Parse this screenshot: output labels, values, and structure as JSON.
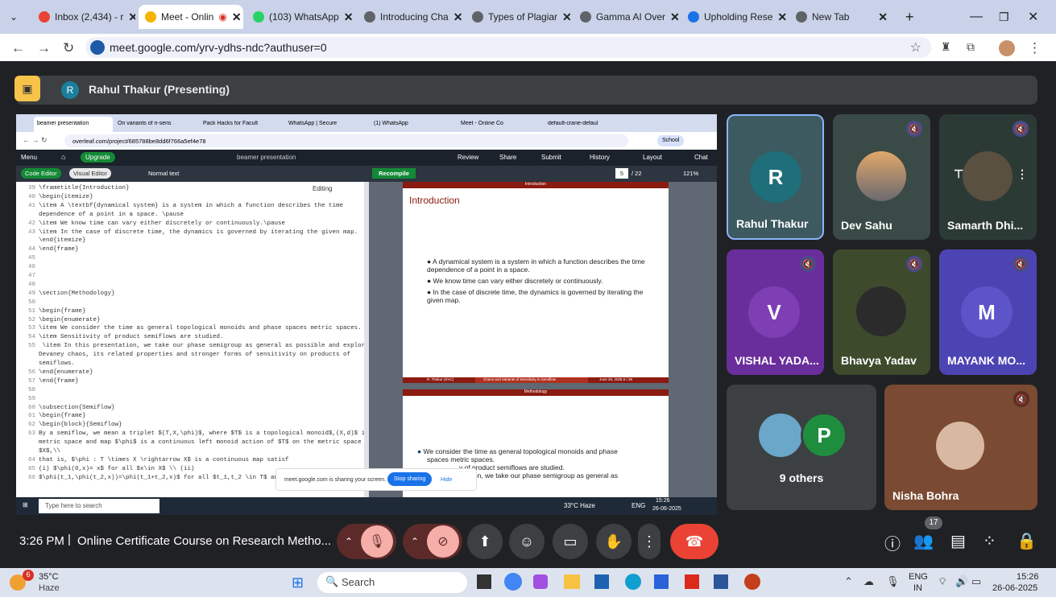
{
  "browser_tabs": [
    {
      "label": "Inbox (2,434) - r"
    },
    {
      "label": "Meet - Onlin"
    },
    {
      "label": "(103) WhatsApp"
    },
    {
      "label": "Introducing Cha"
    },
    {
      "label": "Types of Plagiar"
    },
    {
      "label": "Gamma AI Over"
    },
    {
      "label": "Upholding Rese"
    },
    {
      "label": "New Tab"
    }
  ],
  "url": "meet.google.com/yrv-ydhs-ndc?authuser=0",
  "presenter": {
    "initial": "R",
    "label": "Rahul Thakur (Presenting)"
  },
  "inner": {
    "tabs": [
      "beamer presentation",
      "On variants of n-sens",
      "Pack Hacks for Facult",
      "WhatsApp | Secure",
      "(1) WhatsApp",
      "Meet - Online Co",
      "default-crane-defaul"
    ],
    "url": "overleaf.com/project/685788be8dd6f766a5ef4e78",
    "school": "School",
    "menu": "Menu",
    "upgrade": "Upgrade",
    "title": "beamer presentation",
    "review": "Review",
    "share": "Share",
    "submit": "Submit",
    "history": "History",
    "layout": "Layout",
    "chat": "Chat",
    "code_editor": "Code Editor",
    "visual_editor": "Visual Editor",
    "normal_text": "Normal text",
    "editing": "Editing",
    "recompile": "Recompile",
    "page": "5",
    "pages": "/ 22",
    "zoom": "121%",
    "code_lines": [
      [
        "39",
        "\\frametitle{Introduction}"
      ],
      [
        "40",
        "\\begin{itemize}"
      ],
      [
        "41",
        "\\item A \\textbf{dynamical system} is a system in which a function describes the time"
      ],
      [
        "",
        "dependence of a point in a space. \\pause"
      ],
      [
        "42",
        "\\item We know time can vary either discretely or continuously.\\pause"
      ],
      [
        "43",
        "\\item In the case of discrete time, the dynamics is governed by iterating the given map."
      ],
      [
        "",
        "\\end{itemize}"
      ],
      [
        "44",
        "\\end{frame}"
      ],
      [
        "45",
        ""
      ],
      [
        "46",
        ""
      ],
      [
        "47",
        ""
      ],
      [
        "48",
        ""
      ],
      [
        "49",
        "\\section{Methodology}"
      ],
      [
        "50",
        ""
      ],
      [
        "51",
        "\\begin{frame}"
      ],
      [
        "52",
        "\\begin{enumerate}"
      ],
      [
        "53",
        "\\item  We consider the time as general topological monoids and phase spaces metric spaces."
      ],
      [
        "54",
        "\\item  Sensitivity of product semiflows are studied."
      ],
      [
        "55",
        " \\item In this presentation, we take our phase semigroup as general as possible and explore"
      ],
      [
        "",
        "Devaney chaos, its related properties and stronger forms of sensitivity on products of"
      ],
      [
        "",
        "semiflows."
      ],
      [
        "56",
        "\\end{enumerate}"
      ],
      [
        "57",
        "\\end{frame}"
      ],
      [
        "58",
        ""
      ],
      [
        "59",
        ""
      ],
      [
        "60",
        "\\subsection{Semiflow}"
      ],
      [
        "61",
        "\\begin{frame}"
      ],
      [
        "62",
        "\\begin{block}{Semiflow}"
      ],
      [
        "63",
        "By a semiflow, we mean a triplet $(T,X,\\phi)$, where $T$ is  a topological monoid$,(X,d)$ is a"
      ],
      [
        "",
        "metric space and map $\\phi$ is a continuous left monoid action of $T$ on  the metric space"
      ],
      [
        "",
        "$X$,\\\\"
      ],
      [
        "64",
        "that is,  $\\phi : T \\times X \\rightarrow X$ is a continuous map satisf"
      ],
      [
        "65",
        "(i) $\\phi(0,x)= x$ for all $x\\in X$ \\\\ (ii)"
      ],
      [
        "66",
        "$\\phi(t_1,\\phi(t_2,x))=\\phi(t_1+t_2,x)$ for all    $t_1,t_2 \\in T$ an"
      ]
    ],
    "slide1": {
      "header": "Introduction",
      "title": "Introduction",
      "bullets": [
        "A dynamical system is a system in which a function describes the time dependence of a point in a space.",
        "We know time can vary either discretely or continuously.",
        "In the case of discrete time, the dynamics is governed by iterating the given map."
      ],
      "footer_left": "R. Thakur  (SVC)",
      "footer_mid": "Chaos and Variants of Sensitivity in Semiflow",
      "footer_right": "June 26, 2025        5 / 39"
    },
    "slide2": {
      "header": "Methodology",
      "b1": "We consider the time as general topological monoids and phase",
      "b1b": "spaces metric spaces.",
      "b2": "y of product semiflows are studied.",
      "b3": "In this presentation, we take our phase semigroup as general as"
    },
    "sharing_msg": "meet.google.com is sharing your screen.",
    "stop": "Stop sharing",
    "hide": "Hide",
    "taskbar_search": "Type here to search",
    "weather": "33°C  Haze",
    "lang": "ENG",
    "time": "15:26",
    "date": "26-06-2025"
  },
  "participants": [
    {
      "name": "Rahul Thakur",
      "initial": "R",
      "color": "#1e6f7a"
    },
    {
      "name": "Dev Sahu"
    },
    {
      "name": "Samarth Dhi..."
    },
    {
      "name": "VISHAL YADA...",
      "initial": "V",
      "color": "#7e3fb5"
    },
    {
      "name": "Bhavya Yadav"
    },
    {
      "name": "MAYANK MO...",
      "initial": "M",
      "color": "#5e54c9"
    },
    {
      "name": "9 others",
      "initial": "P"
    },
    {
      "name": "Nisha Bohra"
    }
  ],
  "bottom": {
    "time": "3:26 PM",
    "separator": "|",
    "meeting": "Online Certificate Course on Research Metho...",
    "people_count": "17"
  },
  "win_taskbar": {
    "temp": "35°C",
    "haze": "Haze",
    "badge": "6",
    "search": "Search",
    "lang1": "ENG",
    "lang2": "IN",
    "time": "15:26",
    "date": "26-06-2025"
  }
}
